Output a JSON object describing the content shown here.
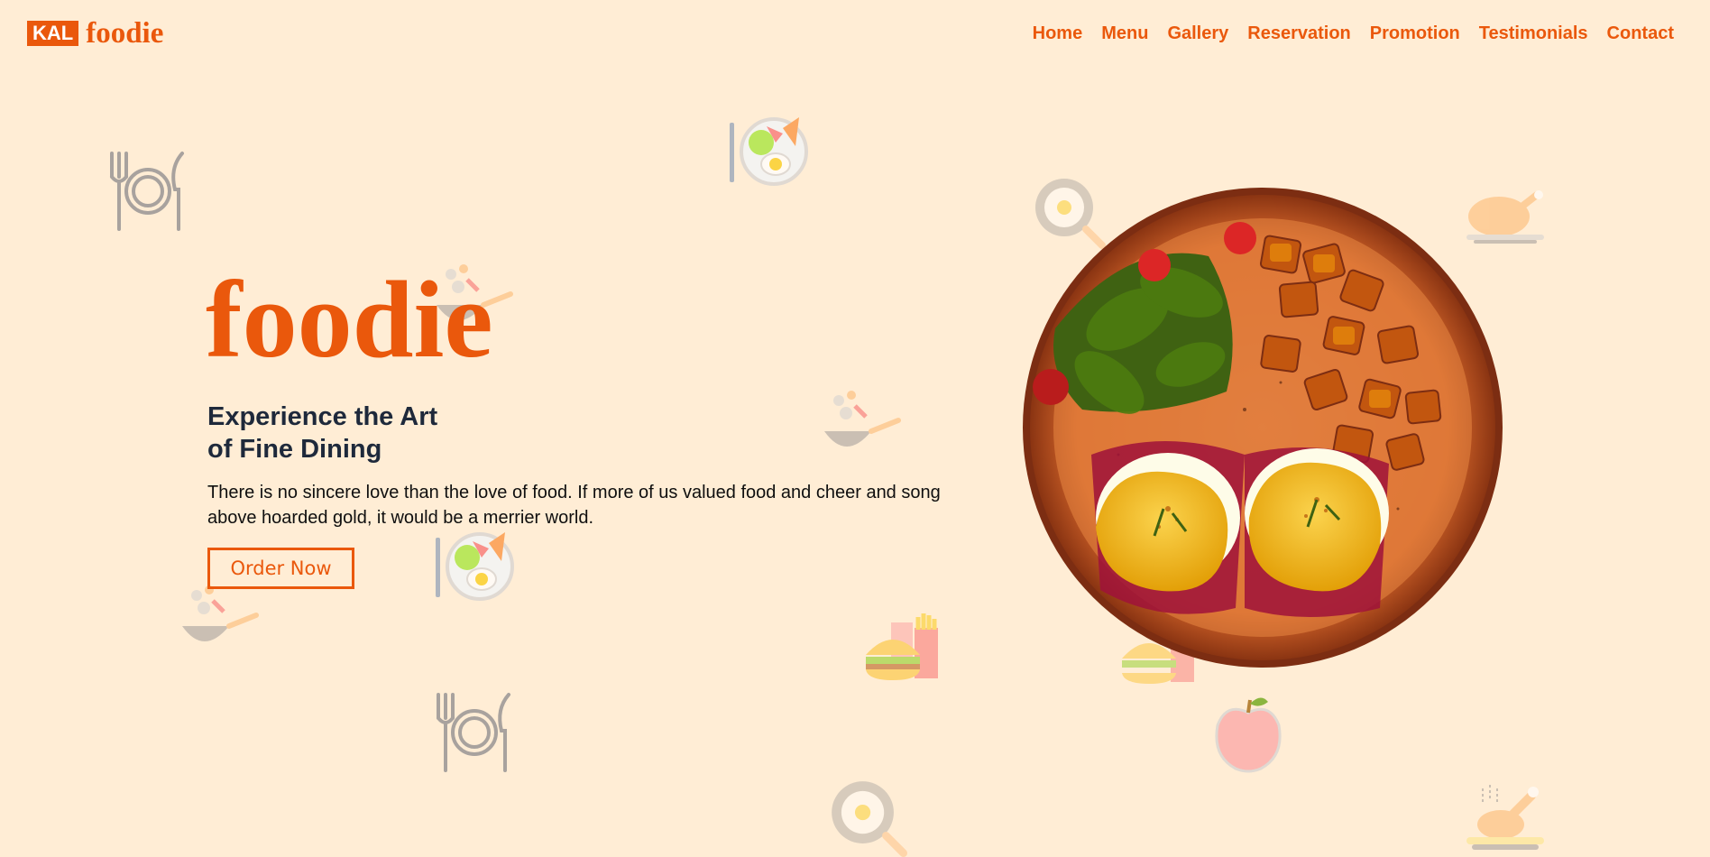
{
  "brand": {
    "badge": "KAL",
    "name": "foodie"
  },
  "nav": {
    "items": [
      "Home",
      "Menu",
      "Gallery",
      "Reservation",
      "Promotion",
      "Testimonials",
      "Contact"
    ]
  },
  "hero": {
    "title": "foodie",
    "subtitle_line1": "Experience the Art",
    "subtitle_line2": "of Fine Dining",
    "text": "There is no sincere love than the love of food. If more of us valued food and cheer and song above hoarded gold, it would be a merrier world.",
    "button_label": "Order Now",
    "image": "food-plate-image"
  },
  "colors": {
    "accent": "#ea580c",
    "background": "#ffedd5",
    "heading": "#1e293b"
  },
  "decorative_icons": [
    "plate-cutlery-icon",
    "salad-bowl-icon",
    "wok-icon",
    "burger-fries-icon",
    "fried-egg-pan-icon",
    "roast-chicken-icon",
    "apple-icon",
    "chicken-legs-icon"
  ]
}
